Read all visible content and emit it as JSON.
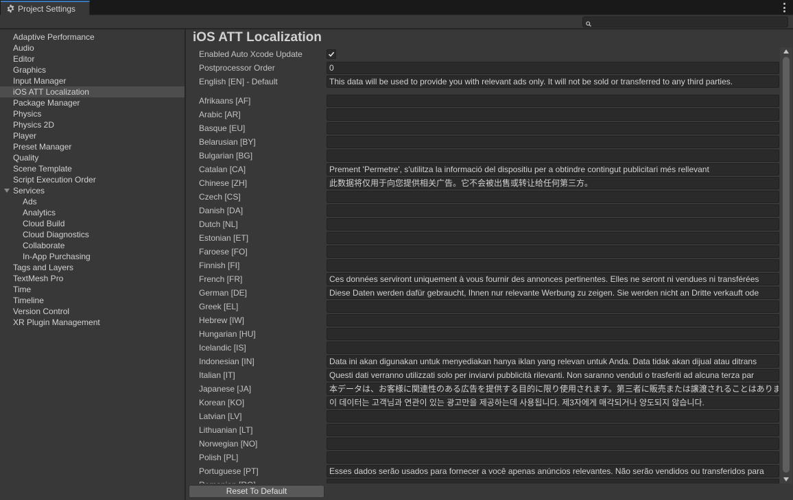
{
  "window": {
    "tab_title": "Project Settings",
    "search": {
      "value": "",
      "placeholder": ""
    }
  },
  "sidebar": {
    "items": [
      {
        "label": "Adaptive Performance",
        "level": 0
      },
      {
        "label": "Audio",
        "level": 0
      },
      {
        "label": "Editor",
        "level": 0
      },
      {
        "label": "Graphics",
        "level": 0
      },
      {
        "label": "Input Manager",
        "level": 0
      },
      {
        "label": "iOS ATT Localization",
        "level": 0,
        "selected": true
      },
      {
        "label": "Package Manager",
        "level": 0
      },
      {
        "label": "Physics",
        "level": 0
      },
      {
        "label": "Physics 2D",
        "level": 0
      },
      {
        "label": "Player",
        "level": 0
      },
      {
        "label": "Preset Manager",
        "level": 0
      },
      {
        "label": "Quality",
        "level": 0
      },
      {
        "label": "Scene Template",
        "level": 0
      },
      {
        "label": "Script Execution Order",
        "level": 0
      },
      {
        "label": "Services",
        "level": 0,
        "expanded": true
      },
      {
        "label": "Ads",
        "level": 1
      },
      {
        "label": "Analytics",
        "level": 1
      },
      {
        "label": "Cloud Build",
        "level": 1
      },
      {
        "label": "Cloud Diagnostics",
        "level": 1
      },
      {
        "label": "Collaborate",
        "level": 1
      },
      {
        "label": "In-App Purchasing",
        "level": 1
      },
      {
        "label": "Tags and Layers",
        "level": 0
      },
      {
        "label": "TextMesh Pro",
        "level": 0
      },
      {
        "label": "Time",
        "level": 0
      },
      {
        "label": "Timeline",
        "level": 0
      },
      {
        "label": "Version Control",
        "level": 0
      },
      {
        "label": "XR Plugin Management",
        "level": 0
      }
    ]
  },
  "main": {
    "title": "iOS ATT Localization",
    "settings": {
      "auto_xcode_label": "Enabled Auto Xcode Update",
      "auto_xcode_checked": true,
      "postprocessor_label": "Postprocessor Order",
      "postprocessor_value": "0",
      "default_label": "English [EN] - Default",
      "default_value": "This data will be used to provide you with relevant ads only. It will not be sold or transferred to any third parties."
    },
    "languages": [
      {
        "label": "Afrikaans [AF]",
        "value": ""
      },
      {
        "label": "Arabic [AR]",
        "value": ""
      },
      {
        "label": "Basque [EU]",
        "value": ""
      },
      {
        "label": "Belarusian [BY]",
        "value": ""
      },
      {
        "label": "Bulgarian [BG]",
        "value": ""
      },
      {
        "label": "Catalan [CA]",
        "value": "Prement 'Permetre', s'utilitza la informació del dispositiu per a obtindre contingut publicitari més rellevant"
      },
      {
        "label": "Chinese [ZH]",
        "value": "此数据将仅用于向您提供相关广告。它不会被出售或转让给任何第三方。"
      },
      {
        "label": "Czech [CS]",
        "value": ""
      },
      {
        "label": "Danish [DA]",
        "value": ""
      },
      {
        "label": "Dutch [NL]",
        "value": ""
      },
      {
        "label": "Estonian [ET]",
        "value": ""
      },
      {
        "label": "Faroese [FO]",
        "value": ""
      },
      {
        "label": "Finnish [FI]",
        "value": ""
      },
      {
        "label": "French [FR]",
        "value": "Ces données serviront uniquement à vous fournir des annonces pertinentes. Elles ne seront ni vendues ni transférées"
      },
      {
        "label": "German [DE]",
        "value": "Diese Daten werden dafür gebraucht, Ihnen nur relevante Werbung zu zeigen. Sie werden nicht an Dritte verkauft ode"
      },
      {
        "label": "Greek [EL]",
        "value": ""
      },
      {
        "label": "Hebrew [IW]",
        "value": ""
      },
      {
        "label": "Hungarian [HU]",
        "value": ""
      },
      {
        "label": "Icelandic [IS]",
        "value": ""
      },
      {
        "label": "Indonesian [IN]",
        "value": "Data ini akan digunakan untuk menyediakan hanya iklan yang relevan untuk Anda. Data tidak akan dijual atau ditrans"
      },
      {
        "label": "Italian [IT]",
        "value": "Questi dati verranno utilizzati solo per inviarvi pubblicità rilevanti. Non saranno venduti  o trasferiti ad alcuna terza par"
      },
      {
        "label": "Japanese [JA]",
        "value": "本データは、お客様に関連性のある広告を提供する目的に限り使用されます。第三者に販売または譲渡されることはありま"
      },
      {
        "label": "Korean [KO]",
        "value": "이 데이터는 고객님과 연관이 있는 광고만을 제공하는데 사용됩니다. 제3자에게 매각되거나 양도되지 않습니다."
      },
      {
        "label": "Latvian [LV]",
        "value": ""
      },
      {
        "label": "Lithuanian [LT]",
        "value": ""
      },
      {
        "label": "Norwegian [NO]",
        "value": ""
      },
      {
        "label": "Polish [PL]",
        "value": ""
      },
      {
        "label": "Portuguese [PT]",
        "value": "Esses dados serão usados para fornecer a você apenas anúncios relevantes. Não serão vendidos ou transferidos para"
      },
      {
        "label": "Romanian [RO]",
        "value": ""
      }
    ],
    "reset_label": "Reset To Default"
  }
}
